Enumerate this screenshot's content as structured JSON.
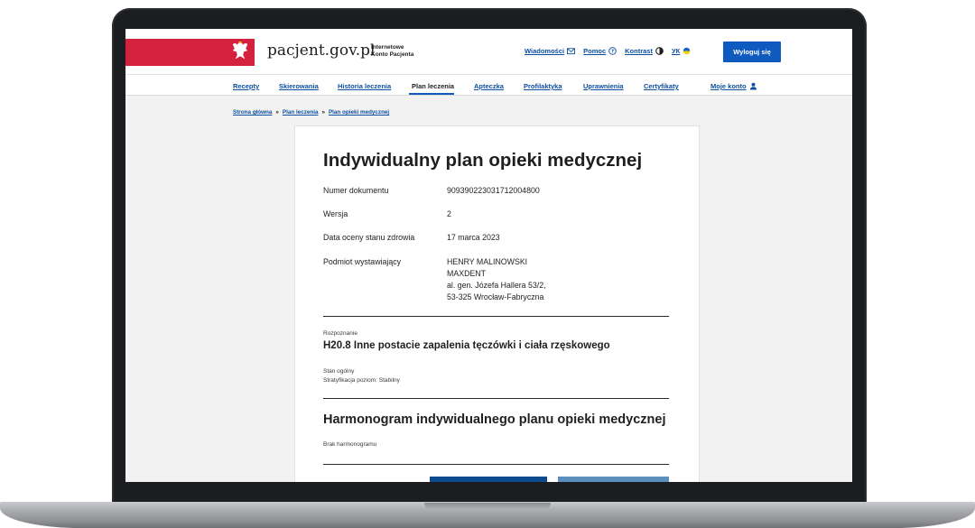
{
  "header": {
    "site_name": "pacjent.gov.pl",
    "site_sub_line1": "Internetowe",
    "site_sub_line2": "Konto Pacjenta",
    "links": [
      {
        "label": "Wiadomości",
        "icon": "envelope-icon"
      },
      {
        "label": "Pomoc",
        "icon": "help-circle-icon"
      },
      {
        "label": "Kontrast",
        "icon": "contrast-icon"
      },
      {
        "label": "УК",
        "icon": "ukraine-flag-icon"
      }
    ],
    "logout_label": "Wyloguj się",
    "colors": {
      "flag_red": "#d4213d",
      "primary_blue": "#0f5abf"
    }
  },
  "nav": {
    "items": [
      "Recepty",
      "Skierowania",
      "Historia leczenia",
      "Plan leczenia",
      "Apteczka",
      "Profilaktyka",
      "Uprawnienia",
      "Certyfikaty"
    ],
    "active": "Plan leczenia",
    "account_label": "Moje konto",
    "account_icon": "user-icon"
  },
  "breadcrumb": {
    "items": [
      "Strona główna",
      "Plan leczenia",
      "Plan opieki medycznej"
    ],
    "separator": "»"
  },
  "document": {
    "title": "Indywidualny plan opieki medycznej",
    "fields": [
      {
        "label": "Numer dokumentu",
        "value": "909390223031712004800"
      },
      {
        "label": "Wersja",
        "value": "2"
      },
      {
        "label": "Data oceny stanu zdrowia",
        "value": "17 marca 2023"
      }
    ],
    "issuer": {
      "label": "Podmiot wystawiający",
      "lines": [
        "HENRY MALINOWSKI",
        "MAXDENT",
        "al. gen. Józefa Hallera 53/2,",
        "53-325 Wrocław-Fabryczna"
      ]
    },
    "diagnosis_label": "Rozpoznanie",
    "diagnosis": "H20.8 Inne postacie zapalenia tęczówki i ciała rzęskowego",
    "general_state_label": "Stan ogólny",
    "general_state_value": "Stratyfikacja poziom: Stabilny",
    "schedule_title": "Harmonogram indywidualnego planu opieki medycznej",
    "schedule_empty": "Brak harmonogramu"
  }
}
